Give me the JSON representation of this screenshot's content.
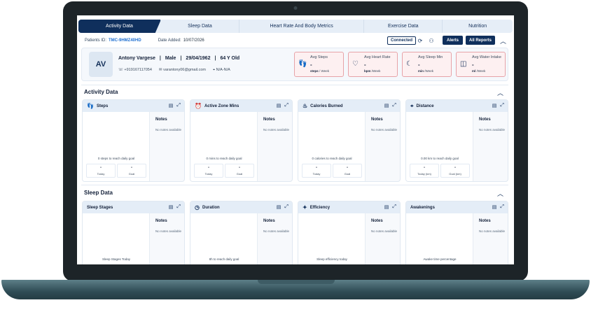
{
  "tabs": [
    {
      "label": "Activity Data"
    },
    {
      "label": "Sleep Data"
    },
    {
      "label": "Heart Rate And Body Metrics"
    },
    {
      "label": "Exercise Data"
    },
    {
      "label": "Nutrition"
    }
  ],
  "info_bar": {
    "patient_id_label": "Patients ID:",
    "patient_id": "TMC-9HMZ40HD",
    "date_added_label": "Date Added:",
    "date_added": "10/07/2026",
    "connected_label": "Connected",
    "alerts_label": "Alerts",
    "all_reports_label": "All Reports"
  },
  "patient": {
    "initials": "AV",
    "name": "Antony Vargese",
    "gender": "Male",
    "dob": "29/04/1962",
    "age": "64 Y Old",
    "phone": "+919167117054",
    "email": "varantony06@gmail.com",
    "location": "N/A-N/A"
  },
  "stats": [
    {
      "title": "Avg Steps",
      "value": "-",
      "unit_bold": "steps",
      "unit": "/ Week",
      "icon": "footsteps-icon"
    },
    {
      "title": "Avg Heart Rate",
      "value": "-",
      "unit_bold": "bpm",
      "unit": "/Week",
      "icon": "heart-pulse-icon"
    },
    {
      "title": "Avg Sleep Min",
      "value": "-",
      "unit_bold": "min",
      "unit": "/Week",
      "icon": "moon-icon"
    },
    {
      "title": "Avg Water Intake",
      "value": "-",
      "unit_bold": "ml",
      "unit": "/Week",
      "icon": "water-glass-icon"
    }
  ],
  "activity": {
    "title": "Activity Data",
    "cards": [
      {
        "title": "Steps",
        "goal_text": "0 steps to reach daily goal",
        "today_value": "-",
        "today_label": "Today",
        "goal_value": "-",
        "goal_label": "Goal",
        "notes_title": "Notes",
        "notes_empty": "No notes available"
      },
      {
        "title": "Active Zone Mins",
        "goal_text": "0 mins to reach daily goal",
        "today_value": "-",
        "today_label": "Today",
        "goal_value": "-",
        "goal_label": "Goal",
        "notes_title": "Notes",
        "notes_empty": "No notes available"
      },
      {
        "title": "Calories Burned",
        "goal_text": "0 calories to reach daily goal",
        "today_value": "-",
        "today_label": "Today",
        "goal_value": "-",
        "goal_label": "Goal",
        "notes_title": "Notes",
        "notes_empty": "No notes available"
      },
      {
        "title": "Distance",
        "goal_text": "0.00 km to reach daily goal",
        "today_value": "-",
        "today_label": "Today (km)",
        "goal_value": "-",
        "goal_label": "Goal (km)",
        "notes_title": "Notes",
        "notes_empty": "No notes available"
      }
    ]
  },
  "sleep": {
    "title": "Sleep Data",
    "cards": [
      {
        "title": "Sleep Stages",
        "caption": "Sleep Stages Today",
        "notes_title": "Notes",
        "notes_empty": "No notes available"
      },
      {
        "title": "Duration",
        "caption": "8h to reach daily goal",
        "notes_title": "Notes",
        "notes_empty": "No notes available"
      },
      {
        "title": "Efficiency",
        "caption": "Sleep efficiency today",
        "notes_title": "Notes",
        "notes_empty": "No notes available"
      },
      {
        "title": "Awakenings",
        "caption": "Awake time percentage",
        "notes_title": "Notes",
        "notes_empty": "No notes available"
      }
    ]
  },
  "colors": {
    "primary": "#0f2f5c",
    "accent": "#1f6fd1",
    "stat_border": "#e7a3a8",
    "stat_bg": "#fdf0f1"
  }
}
